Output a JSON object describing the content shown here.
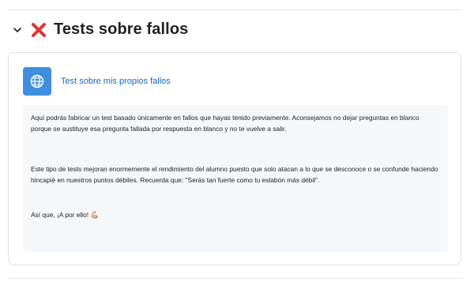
{
  "section": {
    "title": "Tests sobre fallos",
    "toggle_icon": "chevron-down-icon",
    "status_icon": "red-cross-icon"
  },
  "activity": {
    "icon": "globe-icon",
    "link_text": "Test sobre mis propios fallos"
  },
  "description": {
    "paragraph1": "Aquí podrás fabricar un test basado únicamente en fallos que hayas tenido previamente. Aconsejamos no dejar preguntas en blanco porque se sustituye esa pregunta fallada por respuesta en blanco y no te vuelve a salir.",
    "paragraph2": "Este tipo de tests mejoran enormemente el rendimiento del alumno puesto que solo atacan a lo que se desconoce o se confunde haciendo hincapié en nuestros puntos débiles. Recuerda que: \"Serás tan fuerte como tu eslabón más débil\".",
    "paragraph3": "Así que, ¡A por ello!",
    "paragraph3_emoji": "💪🏼"
  },
  "colors": {
    "accent": "#0f6cbf",
    "icon_bg": "#3f8ee0",
    "status_red": "#e8322f"
  }
}
